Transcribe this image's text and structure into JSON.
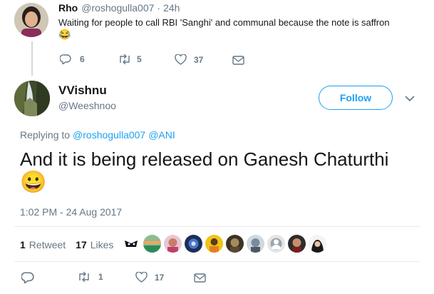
{
  "reply_parent": {
    "display_name": "Rho",
    "handle": "@roshogulla007",
    "separator": "·",
    "time": "24h",
    "text": "Waiting for people to call RBI 'Sanghi' and communal because the note is saffron",
    "emoji": "😂",
    "actions": {
      "reply_count": "6",
      "retweet_count": "5",
      "like_count": "37"
    }
  },
  "tweet": {
    "display_name": "VVishnu",
    "handle": "@Weeshnoo",
    "follow_label": "Follow",
    "replying_prefix": "Replying to",
    "replying_to_1": "@roshogulla007",
    "replying_to_2": "@ANI",
    "text": "And it is being released on Ganesh Chaturthi",
    "emoji": "😀",
    "timestamp": "1:02 PM - 24 Aug 2017",
    "stats": {
      "retweets_num": "1",
      "retweets_label": "Retweet",
      "likes_num": "17",
      "likes_label": "Likes"
    },
    "actions": {
      "retweet_count": "1",
      "like_count": "17"
    }
  },
  "colors": {
    "accent": "#1da1f2",
    "muted": "#657786",
    "divider": "#e6ecf0"
  },
  "icons": [
    "reply-icon",
    "retweet-icon",
    "heart-icon",
    "message-icon",
    "chevron-down-icon"
  ]
}
